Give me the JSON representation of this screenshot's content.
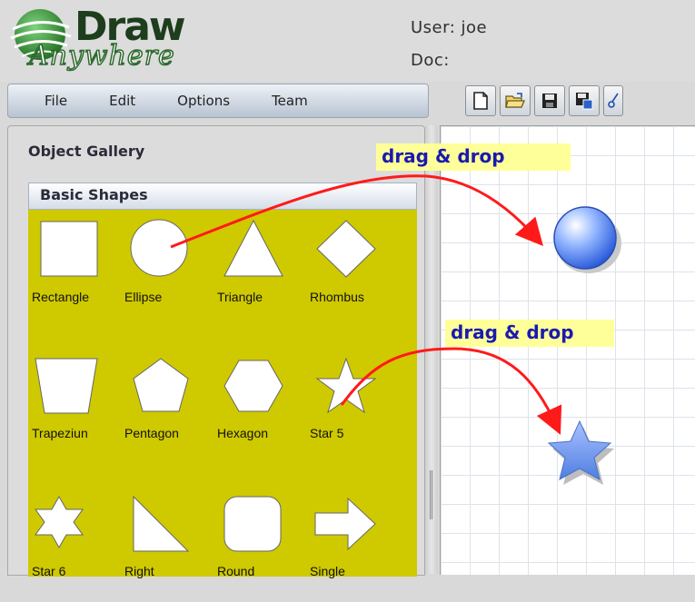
{
  "app": {
    "logo_draw": "Draw",
    "logo_anywhere": "Anywhere",
    "user_line": "User: joe",
    "doc_line": "Doc:"
  },
  "menu": {
    "items": [
      {
        "label": "File"
      },
      {
        "label": "Edit"
      },
      {
        "label": "Options"
      },
      {
        "label": "Team"
      }
    ]
  },
  "toolbar": {
    "buttons": [
      "new-document-icon",
      "open-folder-icon",
      "save-icon",
      "save-as-icon",
      "cut-icon"
    ]
  },
  "gallery": {
    "title": "Object Gallery",
    "section": "Basic Shapes",
    "panel_color": "#cfc900",
    "shapes": [
      {
        "label": "Rectangle"
      },
      {
        "label": "Ellipse"
      },
      {
        "label": "Triangle"
      },
      {
        "label": "Rhombus"
      },
      {
        "label": "Trapeziun"
      },
      {
        "label": "Pentagon"
      },
      {
        "label": "Hexagon"
      },
      {
        "label": "Star 5"
      },
      {
        "label": "Star 6"
      },
      {
        "label": "Right"
      },
      {
        "label": "Round"
      },
      {
        "label": "Single"
      }
    ]
  },
  "annotations": [
    {
      "text": "drag & drop"
    },
    {
      "text": "drag & drop"
    }
  ],
  "colors": {
    "arrow": "#ff1a1a",
    "callout_bg": "#ffff99",
    "callout_text": "#1a1ab0"
  }
}
